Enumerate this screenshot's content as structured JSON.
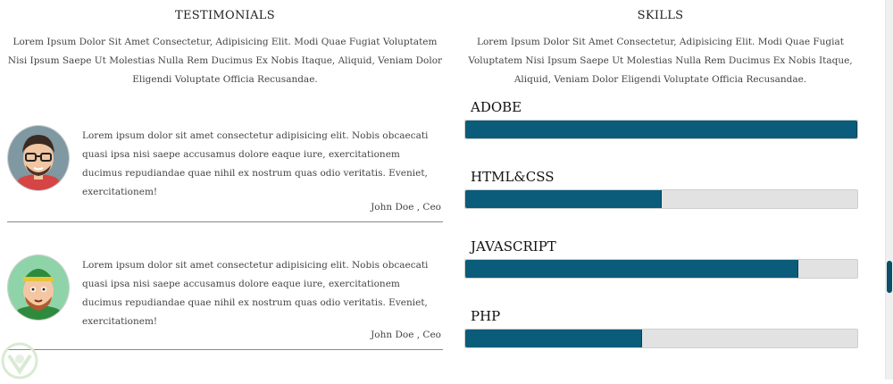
{
  "testimonials": {
    "title": "TESTIMONIALS",
    "intro": "Lorem Ipsum Dolor Sit Amet Consectetur, Adipisicing Elit. Modi Quae Fugiat Voluptatem Nisi Ipsum Saepe Ut Molestias Nulla Rem Ducimus Ex Nobis Itaque, Aliquid, Veniam Dolor Eligendi Voluptate Officia Recusandae.",
    "items": [
      {
        "text": "Lorem ipsum dolor sit amet consectetur adipisicing elit. Nobis obcaecati quasi ipsa nisi saepe accusamus dolore eaque iure, exercitationem ducimus repudiandae quae nihil ex nostrum quas odio veritatis. Eveniet, exercitationem!",
        "author": "John Doe , Ceo",
        "avatar_icon": "man-glasses-avatar-icon"
      },
      {
        "text": "Lorem ipsum dolor sit amet consectetur adipisicing elit. Nobis obcaecati quasi ipsa nisi saepe accusamus dolore eaque iure, exercitationem ducimus repudiandae quae nihil ex nostrum quas odio veritatis. Eveniet, exercitationem!",
        "author": "John Doe , Ceo",
        "avatar_icon": "man-hat-avatar-icon"
      }
    ]
  },
  "skills": {
    "title": "SKILLS",
    "intro": "Lorem Ipsum Dolor Sit Amet Consectetur, Adipisicing Elit. Modi Quae Fugiat Voluptatem Nisi Ipsum Saepe Ut Molestias Nulla Rem Ducimus Ex Nobis Itaque, Aliquid, Veniam Dolor Eligendi Voluptate Officia Recusandae.",
    "items": [
      {
        "label": "ADOBE",
        "percent": 100
      },
      {
        "label": "HTML&CSS",
        "percent": 50
      },
      {
        "label": "JAVASCRIPT",
        "percent": 85
      },
      {
        "label": "PHP",
        "percent": 45
      }
    ],
    "bar_color": "#0a5c7a",
    "track_color": "#e2e2e2"
  }
}
